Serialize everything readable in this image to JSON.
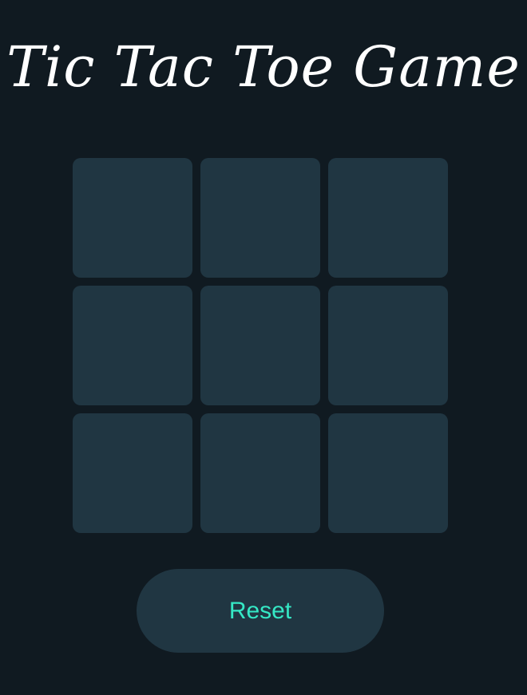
{
  "title": "Tic Tac Toe Game",
  "board": {
    "cells": [
      "",
      "",
      "",
      "",
      "",
      "",
      "",
      "",
      ""
    ]
  },
  "controls": {
    "reset_label": "Reset"
  },
  "colors": {
    "background": "#101a21",
    "cell": "#203642",
    "accent": "#35e8c5",
    "title": "#ffffff"
  }
}
